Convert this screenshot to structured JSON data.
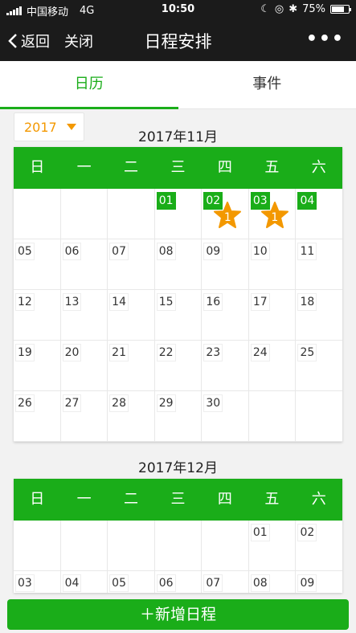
{
  "status": {
    "carrier": "中国移动",
    "network": "4G",
    "time": "10:50",
    "battery": "75%",
    "battery_level": 0.75
  },
  "nav": {
    "back": "返回",
    "close": "关闭",
    "title": "日程安排",
    "more": "•••"
  },
  "tabs": [
    "日历",
    "事件"
  ],
  "year_select": "2017",
  "weekdays": [
    "日",
    "一",
    "二",
    "三",
    "四",
    "五",
    "六"
  ],
  "months": [
    {
      "title": "2017年11月",
      "weeks": [
        [
          "",
          "",
          "",
          "01",
          "02",
          "03",
          "04"
        ],
        [
          "05",
          "06",
          "07",
          "08",
          "09",
          "10",
          "11"
        ],
        [
          "12",
          "13",
          "14",
          "15",
          "16",
          "17",
          "18"
        ],
        [
          "19",
          "20",
          "21",
          "22",
          "23",
          "24",
          "25"
        ],
        [
          "26",
          "27",
          "28",
          "29",
          "30",
          "",
          ""
        ]
      ],
      "highlighted": [
        "01",
        "02",
        "03",
        "04"
      ],
      "events": {
        "02": "1",
        "03": "1"
      }
    },
    {
      "title": "2017年12月",
      "weeks": [
        [
          "",
          "",
          "",
          "",
          "",
          "01",
          "02"
        ],
        [
          "03",
          "04",
          "05",
          "06",
          "07",
          "08",
          "09"
        ]
      ],
      "highlighted": [],
      "events": {}
    }
  ],
  "add_button": "＋新增日程",
  "colors": {
    "accent": "#1aad19",
    "orange": "#f39800",
    "bar": "#1b1b1b"
  }
}
